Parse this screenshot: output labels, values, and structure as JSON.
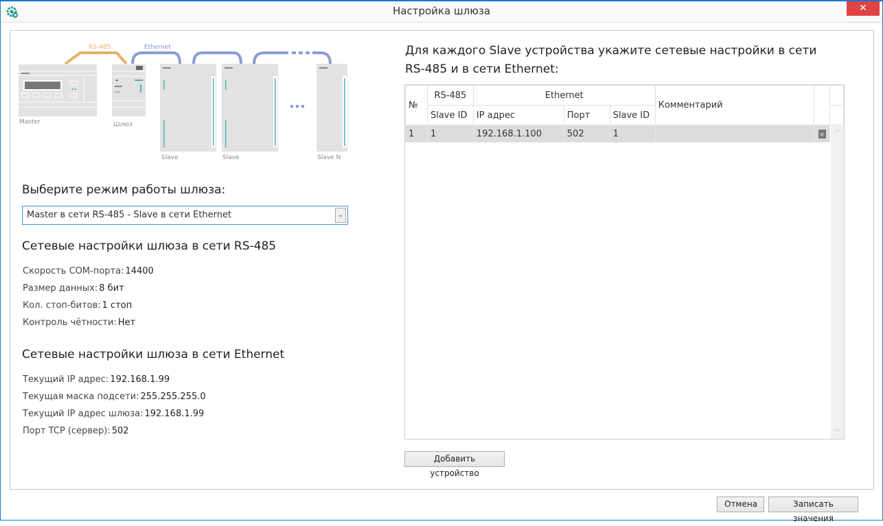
{
  "window": {
    "title": "Настройка шлюза",
    "close_glyph": "✕",
    "icon": "gear-app-icon"
  },
  "diagram": {
    "cable_rs485": "RS-485",
    "cable_ethernet": "Ethernet",
    "master_label": "Master",
    "gateway_label": "Шлюз",
    "slave_labels": [
      "Slave",
      "Slave",
      "Slave N"
    ],
    "ellipsis": "• • •",
    "colors": {
      "rs485": "#e8b06a",
      "ethernet": "#8a9dd4",
      "device": "#e2e2e2",
      "led": "#4fb3b0"
    }
  },
  "mode": {
    "heading": "Выберите режим работы шлюза:",
    "selected": "Master в сети RS-485 - Slave в сети Ethernet",
    "arrow_glyph": "⌄"
  },
  "rs485": {
    "heading": "Сетевые настройки шлюза в сети RS-485",
    "items": [
      {
        "label": "Скорость COM-порта:",
        "value": "14400"
      },
      {
        "label": "Размер данных:",
        "value": "8 бит"
      },
      {
        "label": "Кол. стоп-битов:",
        "value": "1 стоп"
      },
      {
        "label": "Контроль чётности:",
        "value": "Нет"
      }
    ]
  },
  "ethernet": {
    "heading": "Сетевые настройки шлюза в сети Ethernet",
    "items": [
      {
        "label": "Текущий IP адрес:",
        "value": "192.168.1.99"
      },
      {
        "label": "Текущая маска подсети:",
        "value": "255.255.255.0"
      },
      {
        "label": "Текущий IP адрес шлюза:",
        "value": "192.168.1.99"
      },
      {
        "label": "Порт TCP (сервер):",
        "value": "502"
      }
    ]
  },
  "slaves": {
    "heading": "Для каждого Slave устройства укажите сетевые настройки в сети RS-485 и в сети Ethernet:",
    "header_top": {
      "num": "№",
      "rs485": "RS-485",
      "ethernet": "Ethernet",
      "comment": "Комментарий"
    },
    "header_sub": {
      "rs_slave_id": "Slave ID",
      "ip": "IP адрес",
      "port": "Порт",
      "eth_slave_id": "Slave ID"
    },
    "rows": [
      {
        "num": "1",
        "rs_slave_id": "1",
        "ip": "192.168.1.100",
        "port": "502",
        "eth_slave_id": "1",
        "comment": ""
      }
    ],
    "add_button": "Добавить устройство"
  },
  "footer": {
    "cancel": "Отмена",
    "write": "Записать значения"
  }
}
